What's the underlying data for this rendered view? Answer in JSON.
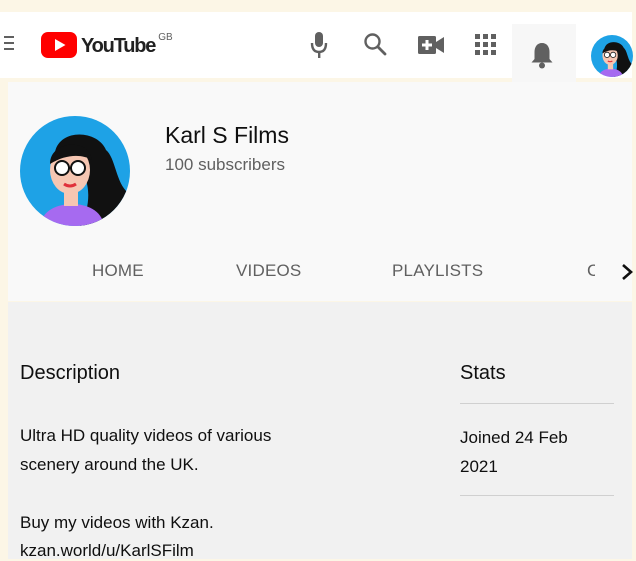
{
  "header": {
    "logo_text": "YouTube",
    "country_code": "GB"
  },
  "channel": {
    "name": "Karl S Films",
    "subscribers": "100 subscribers"
  },
  "tabs": [
    "HOME",
    "VIDEOS",
    "PLAYLISTS",
    "C"
  ],
  "about": {
    "description_title": "Description",
    "description_lines": [
      "Ultra HD quality videos of various",
      "scenery around the UK.",
      "Buy my videos with Kzan.",
      "kzan.world/u/KarlSFilm"
    ],
    "stats_title": "Stats",
    "joined": "Joined 24 Feb 2021"
  },
  "icons": {
    "menu": "hamburger-menu-icon",
    "logo": "youtube-play-icon",
    "mic": "microphone-icon",
    "search": "search-icon",
    "create": "create-video-icon",
    "apps": "apps-grid-icon",
    "notifications": "bell-icon",
    "account": "account-avatar",
    "next": "chevron-right-icon"
  },
  "colors": {
    "brand_red": "#ff0000",
    "avatar_bg": "#1ea2e6",
    "avatar_shirt": "#a66af0",
    "text_primary": "#0f0f0f",
    "text_secondary": "#606060",
    "page_bg": "#fcf6e6"
  }
}
